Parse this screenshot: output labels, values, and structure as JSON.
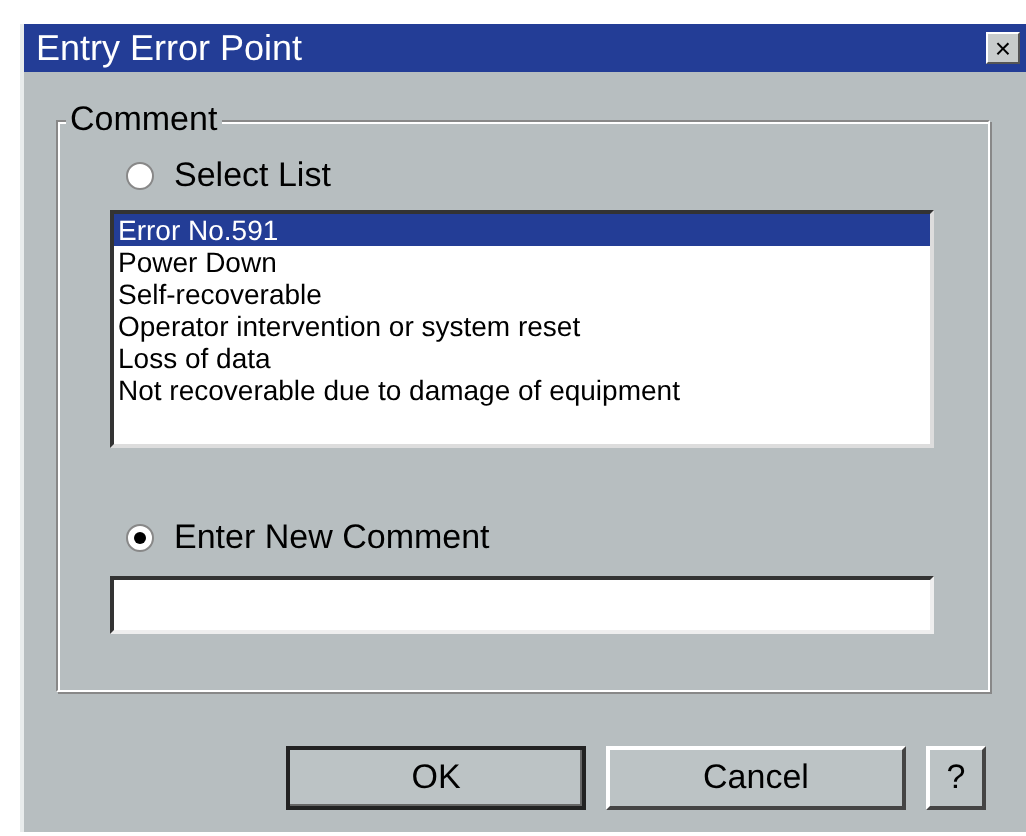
{
  "window": {
    "title": "Entry Error Point",
    "close": "×"
  },
  "group": {
    "label": "Comment",
    "options": [
      {
        "label": "Select List",
        "selected": false
      },
      {
        "label": "Enter New Comment",
        "selected": true
      }
    ],
    "list": [
      {
        "text": "Error No.591",
        "selected": true
      },
      {
        "text": "Power Down",
        "selected": false
      },
      {
        "text": "Self-recoverable",
        "selected": false
      },
      {
        "text": "Operator intervention or system reset",
        "selected": false
      },
      {
        "text": "Loss of data",
        "selected": false
      },
      {
        "text": "Not recoverable due to damage of equipment",
        "selected": false
      }
    ]
  },
  "buttons": [
    {
      "label": "OK",
      "kind": "default"
    },
    {
      "label": "Cancel",
      "kind": "normal"
    },
    {
      "label": "?",
      "kind": "help"
    }
  ]
}
